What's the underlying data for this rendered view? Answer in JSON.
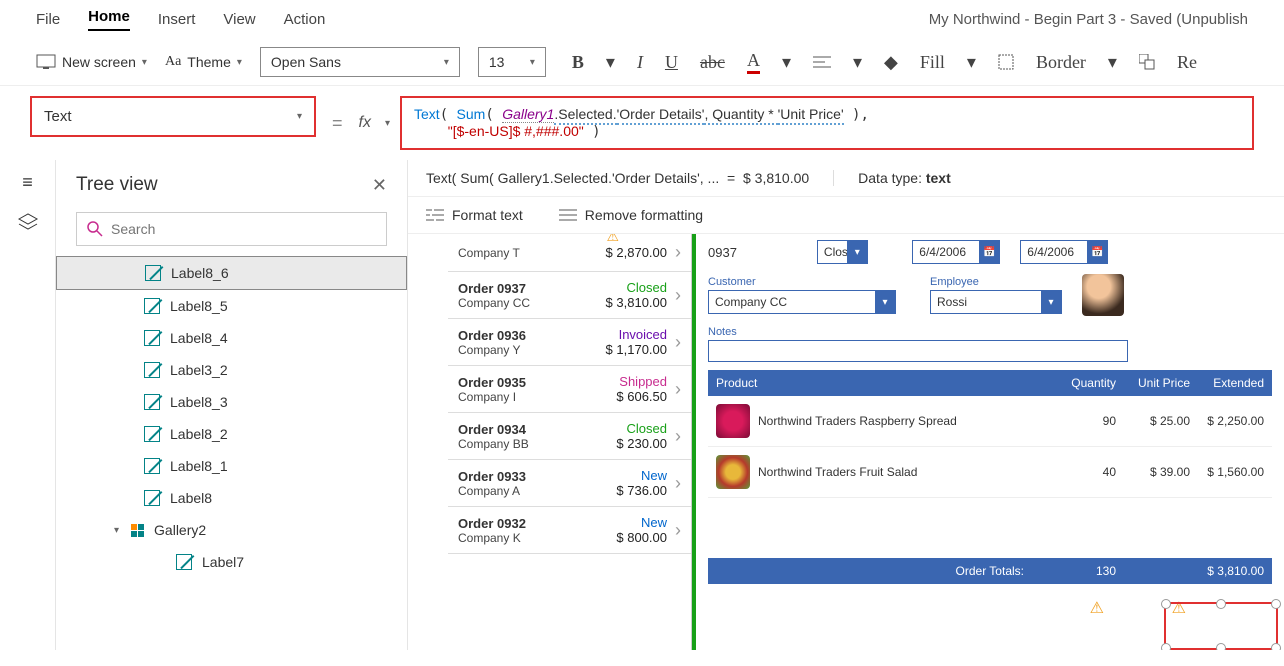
{
  "doc_title": "My Northwind - Begin Part 3 - Saved (Unpublish",
  "menu": {
    "file": "File",
    "home": "Home",
    "insert": "Insert",
    "view": "View",
    "action": "Action"
  },
  "toolbar": {
    "new_screen": "New screen",
    "theme": "Theme",
    "font": "Open Sans",
    "size": "13",
    "fill": "Fill",
    "border": "Border",
    "re": "Re"
  },
  "property": {
    "name": "Text",
    "eq": "=",
    "fx": "fx"
  },
  "formula": {
    "fn1": "Text",
    "fn2": "Sum",
    "id": "Gallery1",
    "f1": ".Selected.",
    "f2": "'Order Details'",
    "f3": ", Quantity * ",
    "f4": "'Unit Price'",
    "str": "\"[$-en-US]$ #,###.00\""
  },
  "result": {
    "expr": "Text( Sum( Gallery1.Selected.'Order Details', ...",
    "eq": "=",
    "val": "$ 3,810.00",
    "type_lbl": "Data type: ",
    "type": "text"
  },
  "fmtbar": {
    "format": "Format text",
    "remove": "Remove formatting"
  },
  "tree": {
    "title": "Tree view",
    "search_ph": "Search",
    "items": [
      {
        "label": "Label8_6",
        "kind": "label",
        "selected": true,
        "indent": "item"
      },
      {
        "label": "Label8_5",
        "kind": "label",
        "indent": "item"
      },
      {
        "label": "Label8_4",
        "kind": "label",
        "indent": "item"
      },
      {
        "label": "Label3_2",
        "kind": "label",
        "indent": "item"
      },
      {
        "label": "Label8_3",
        "kind": "label",
        "indent": "item"
      },
      {
        "label": "Label8_2",
        "kind": "label",
        "indent": "item"
      },
      {
        "label": "Label8_1",
        "kind": "label",
        "indent": "item"
      },
      {
        "label": "Label8",
        "kind": "label",
        "indent": "item"
      },
      {
        "label": "Gallery2",
        "kind": "gallery",
        "indent": "gal",
        "expanded": true
      },
      {
        "label": "Label7",
        "kind": "label",
        "indent": "sub"
      }
    ]
  },
  "orders": [
    {
      "num": "",
      "company": "Company T",
      "status": "",
      "price": "$ 2,870.00",
      "warn": true,
      "cls": ""
    },
    {
      "num": "Order 0937",
      "company": "Company CC",
      "status": "Closed",
      "price": "$ 3,810.00",
      "cls": "closed"
    },
    {
      "num": "Order 0936",
      "company": "Company Y",
      "status": "Invoiced",
      "price": "$ 1,170.00",
      "cls": "invoiced"
    },
    {
      "num": "Order 0935",
      "company": "Company I",
      "status": "Shipped",
      "price": "$ 606.50",
      "cls": "shipped"
    },
    {
      "num": "Order 0934",
      "company": "Company BB",
      "status": "Closed",
      "price": "$ 230.00",
      "cls": "closed"
    },
    {
      "num": "Order 0933",
      "company": "Company A",
      "status": "New",
      "price": "$ 736.00",
      "cls": "newst"
    },
    {
      "num": "Order 0932",
      "company": "Company K",
      "status": "New",
      "price": "$ 800.00",
      "cls": "newst"
    }
  ],
  "detail": {
    "order": "0937",
    "status": "Closed",
    "date1": "6/4/2006",
    "date2": "6/4/2006",
    "cust_lbl": "Customer",
    "cust": "Company CC",
    "emp_lbl": "Employee",
    "emp": "Rossi",
    "notes_lbl": "Notes",
    "head": {
      "p": "Product",
      "q": "Quantity",
      "u": "Unit Price",
      "e": "Extended"
    },
    "rows": [
      {
        "name": "Northwind Traders Raspberry Spread",
        "q": "90",
        "u": "$ 25.00",
        "e": "$ 2,250.00",
        "img": "berry"
      },
      {
        "name": "Northwind Traders Fruit Salad",
        "q": "40",
        "u": "$ 39.00",
        "e": "$ 1,560.00",
        "img": "salad"
      }
    ],
    "totals": {
      "lbl": "Order Totals:",
      "q": "130",
      "e": "$ 3,810.00"
    }
  }
}
